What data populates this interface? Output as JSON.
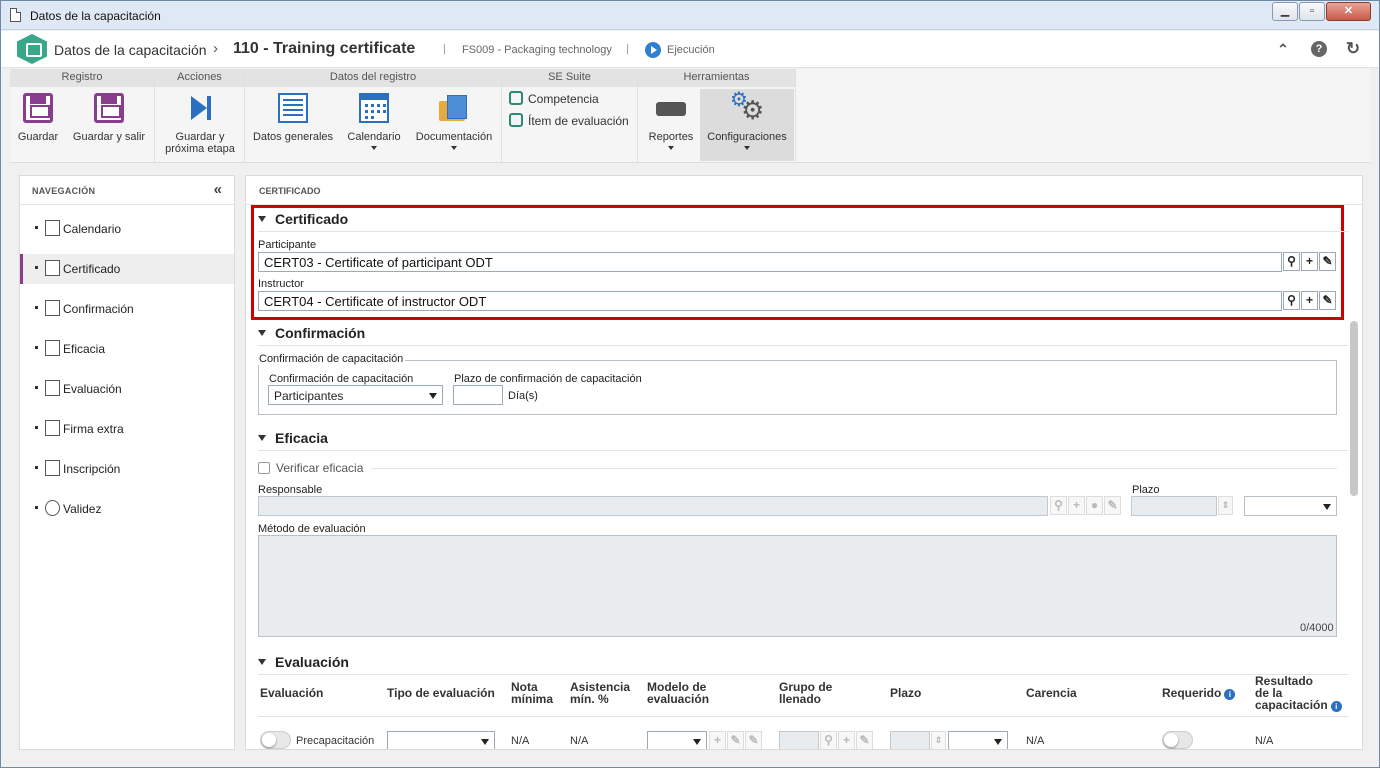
{
  "window": {
    "title": "Datos de la capacitación"
  },
  "header": {
    "app_name": "Datos de la capacitación",
    "separator": "›",
    "record_title": "110 - Training certificate",
    "pipe": "|",
    "subtitle": "FS009 - Packaging technology",
    "status": "Ejecución"
  },
  "ribbon": {
    "groups": [
      {
        "title": "Registro",
        "buttons": [
          "Guardar",
          "Guardar y salir"
        ]
      },
      {
        "title": "Acciones",
        "buttons": [
          "Guardar y\npróxima etapa"
        ]
      },
      {
        "title": "Datos del registro",
        "buttons": [
          "Datos generales",
          "Calendario",
          "Documentación"
        ]
      },
      {
        "title": "SE Suite",
        "links": [
          "Competencia",
          "Ítem de evaluación"
        ]
      },
      {
        "title": "Herramientas",
        "buttons": [
          "Reportes",
          "Configuraciones"
        ]
      }
    ],
    "save_label": "Guardar",
    "save_exit_label": "Guardar y salir",
    "save_next_line1": "Guardar y",
    "save_next_line2": "próxima etapa",
    "general_label": "Datos generales",
    "calendar_label": "Calendario",
    "docs_label": "Documentación",
    "competence_label": "Competencia",
    "eval_item_label": "Ítem de evaluación",
    "reports_label": "Reportes",
    "config_label": "Configuraciones"
  },
  "nav": {
    "title": "NAVEGACIÓN",
    "collapse": "«",
    "items": [
      {
        "label": "Calendario",
        "icon": "calendar-icon"
      },
      {
        "label": "Certificado",
        "icon": "certificate-icon"
      },
      {
        "label": "Confirmación",
        "icon": "confirmation-icon"
      },
      {
        "label": "Eficacia",
        "icon": "efficacy-icon"
      },
      {
        "label": "Evaluación",
        "icon": "evaluation-icon"
      },
      {
        "label": "Firma extra",
        "icon": "signature-icon"
      },
      {
        "label": "Inscripción",
        "icon": "enrollment-icon"
      },
      {
        "label": "Validez",
        "icon": "clock-icon"
      }
    ],
    "selected": "Certificado"
  },
  "content": {
    "title": "CERTIFICADO",
    "certificado": {
      "section": "Certificado",
      "participant_label": "Participante",
      "participant_value": "CERT03 - Certificate of participant ODT",
      "instructor_label": "Instructor",
      "instructor_value": "CERT04 - Certificate of instructor ODT"
    },
    "confirmacion": {
      "section": "Confirmación",
      "legend": "Confirmación de capacitación",
      "confirm_label": "Confirmación de capacitación",
      "confirm_value": "Participantes",
      "deadline_label": "Plazo de confirmación de capacitación",
      "deadline_value": "",
      "deadline_unit": "Día(s)"
    },
    "eficacia": {
      "section": "Eficacia",
      "verify_label": "Verificar eficacia",
      "responsible_label": "Responsable",
      "term_label": "Plazo",
      "method_label": "Método de evaluación",
      "counter": "0/4000"
    },
    "evaluacion": {
      "section": "Evaluación",
      "columns": {
        "evaluacion": "Evaluación",
        "tipo": "Tipo de evaluación",
        "nota_1": "Nota",
        "nota_2": "mínima",
        "asist_1": "Asistencia",
        "asist_2": "mín. %",
        "modelo_1": "Modelo de",
        "modelo_2": "evaluación",
        "grupo_1": "Grupo de",
        "grupo_2": "llenado",
        "plazo": "Plazo",
        "carencia": "Carencia",
        "requerido": "Requerido",
        "resultado_1": "Resultado",
        "resultado_2": "de la",
        "resultado_3": "capacitación"
      },
      "row": {
        "evaluacion": "Precapacitación",
        "nota": "N/A",
        "asistencia": "N/A",
        "carencia": "N/A",
        "resultado": "N/A"
      }
    }
  },
  "colors": {
    "accent": "#8a3d8c",
    "highlight": "#d00000",
    "brand": "#3aa68a",
    "link_blue": "#2b6fc0"
  }
}
